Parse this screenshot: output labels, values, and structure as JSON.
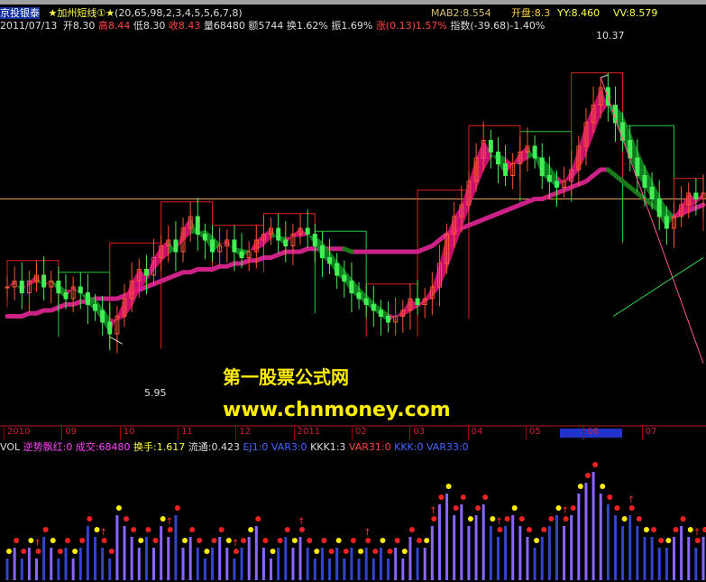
{
  "header": {
    "stock_name": "京投银泰",
    "indicator": "★加州短线①★",
    "params": "(20,65,98,2,3,4,5,5,6,7,8)",
    "mab2": "MAB2:8.554",
    "open_line": "开盘:8.3",
    "yy": "YY:8.460",
    "vv": "VV:8.579"
  },
  "ohlc": {
    "date": "2011/07/13",
    "open": "开8.30",
    "high": "高8.44",
    "low": "低8.30",
    "close": "收8.43",
    "volume": "量68480",
    "amount": "额5744",
    "turnover": "换1.62%",
    "amplitude": "振1.69%",
    "change": "涨(0.13)1.57%",
    "index": "指数(-39.68)-1.40%"
  },
  "vol_header": {
    "vol": "VOL",
    "a": "逆势飘红:0",
    "b": "成交:68480",
    "c": "换手:1.617",
    "d": "流通:0.423",
    "e": "EJ1:0",
    "f": "VAR3:0",
    "g": "KKK1:3",
    "h": "VAR31:0",
    "i": "KKK:0",
    "j": "VAR33:0"
  },
  "watermark": {
    "line1": "第一股票公式网",
    "line2": "www.chnmoney.com"
  },
  "chart_data": {
    "type": "candlestick",
    "title": "京投银泰",
    "x_months": [
      "2010",
      "09",
      "10",
      "11",
      "12",
      "2011",
      "02",
      "03",
      "04",
      "05",
      "06",
      "07"
    ],
    "ylim": [
      5.0,
      11.0
    ],
    "annotations": {
      "high_label": "10.37",
      "low_label": "5.95",
      "high_value": 10.37,
      "low_value": 5.95
    },
    "reference_line": 8.3,
    "close_series": [
      6.8,
      6.9,
      6.7,
      6.9,
      7.0,
      6.8,
      6.9,
      6.7,
      6.6,
      6.8,
      6.7,
      6.5,
      6.4,
      6.2,
      6.0,
      6.3,
      6.6,
      6.9,
      7.1,
      7.0,
      7.3,
      7.5,
      7.6,
      7.4,
      7.8,
      8.0,
      7.7,
      7.6,
      7.4,
      7.5,
      7.6,
      7.4,
      7.3,
      7.4,
      7.6,
      7.7,
      7.8,
      7.6,
      7.5,
      7.7,
      7.8,
      7.7,
      7.5,
      7.3,
      7.2,
      7.0,
      6.9,
      6.7,
      6.6,
      6.5,
      6.4,
      6.3,
      6.2,
      6.3,
      6.4,
      6.6,
      6.5,
      6.6,
      6.8,
      7.2,
      7.7,
      8.0,
      8.2,
      8.6,
      9.0,
      9.3,
      9.1,
      8.9,
      8.7,
      8.9,
      9.1,
      9.2,
      9.0,
      8.7,
      8.6,
      8.5,
      8.6,
      8.8,
      9.2,
      9.6,
      9.9,
      10.2,
      9.9,
      9.6,
      9.3,
      9.0,
      8.7,
      8.5,
      8.3,
      8.0,
      7.8,
      8.0,
      8.2,
      8.4,
      8.3,
      8.4
    ],
    "ma_series": [
      6.3,
      6.3,
      6.3,
      6.35,
      6.35,
      6.4,
      6.4,
      6.45,
      6.5,
      6.5,
      6.55,
      6.55,
      6.6,
      6.6,
      6.6,
      6.6,
      6.65,
      6.7,
      6.75,
      6.8,
      6.85,
      6.9,
      6.95,
      7.0,
      7.05,
      7.05,
      7.1,
      7.1,
      7.1,
      7.15,
      7.15,
      7.2,
      7.2,
      7.25,
      7.25,
      7.3,
      7.3,
      7.35,
      7.4,
      7.4,
      7.4,
      7.45,
      7.45,
      7.45,
      7.45,
      7.45,
      7.45,
      7.4,
      7.4,
      7.4,
      7.4,
      7.4,
      7.4,
      7.4,
      7.4,
      7.4,
      7.4,
      7.45,
      7.5,
      7.6,
      7.7,
      7.75,
      7.8,
      7.85,
      7.9,
      7.95,
      8.0,
      8.05,
      8.1,
      8.15,
      8.2,
      8.25,
      8.3,
      8.3,
      8.35,
      8.4,
      8.45,
      8.5,
      8.55,
      8.6,
      8.7,
      8.8,
      8.8,
      8.7,
      8.6,
      8.5,
      8.4,
      8.3,
      8.2,
      8.1,
      8.0,
      8.0,
      8.05,
      8.1,
      8.15,
      8.2
    ],
    "volume_series": [
      2,
      3,
      2,
      3,
      2,
      4,
      3,
      2,
      3,
      2,
      3,
      5,
      4,
      3,
      2,
      6,
      5,
      4,
      3,
      4,
      3,
      5,
      4,
      6,
      3,
      4,
      3,
      2,
      3,
      4,
      3,
      2,
      3,
      4,
      5,
      3,
      2,
      3,
      4,
      3,
      4,
      3,
      2,
      3,
      2,
      3,
      2,
      3,
      2,
      3,
      2,
      3,
      2,
      3,
      2,
      4,
      3,
      3,
      5,
      7,
      8,
      6,
      7,
      5,
      6,
      7,
      5,
      4,
      5,
      6,
      5,
      4,
      3,
      4,
      5,
      6,
      5,
      6,
      8,
      9,
      10,
      8,
      7,
      6,
      5,
      6,
      5,
      4,
      4,
      3,
      3,
      4,
      5,
      4,
      3,
      4
    ]
  }
}
